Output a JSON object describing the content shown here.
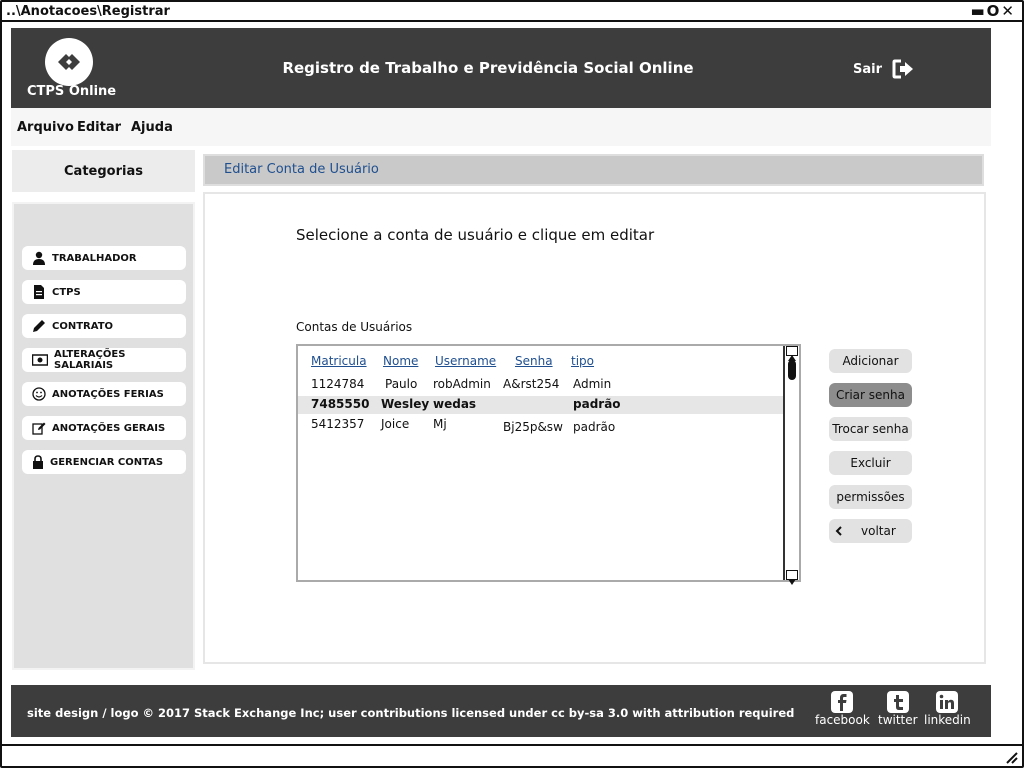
{
  "window": {
    "title": "..\\Anotacoes\\Registrar"
  },
  "header": {
    "logo_text": "CTPS Online",
    "title": "Registro de Trabalho e Previdência Social Online",
    "logout_label": "Sair"
  },
  "menu": {
    "items": [
      "Arquivo",
      "Editar",
      "Ajuda"
    ]
  },
  "sidebar": {
    "heading": "Categorias",
    "items": [
      {
        "label": "TRABALHADOR",
        "icon": "user-icon"
      },
      {
        "label": "CTPS",
        "icon": "document-icon"
      },
      {
        "label": "CONTRATO",
        "icon": "pencil-icon"
      },
      {
        "label": "ALTERAÇÕES SALARIAIS",
        "icon": "money-icon"
      },
      {
        "label": "ANOTAÇÕES FERIAS",
        "icon": "smile-icon"
      },
      {
        "label": "ANOTAÇÕES GERAIS",
        "icon": "edit-icon"
      },
      {
        "label": "GERENCIAR CONTAS",
        "icon": "lock-icon"
      }
    ]
  },
  "page": {
    "title": "Editar Conta de Usuário",
    "instruction": "Selecione a conta de usuário e clique em editar",
    "list_label": "Contas de Usuários"
  },
  "table": {
    "columns": [
      "Matricula",
      "Nome",
      "Username",
      "Senha",
      "tipo"
    ],
    "rows": [
      {
        "matricula": "1124784",
        "nome": "Paulo",
        "username": "robAdmin",
        "senha": "A&rst254",
        "tipo": "Admin"
      },
      {
        "matricula": "7485550",
        "nome": "Wesley",
        "username": "wedas",
        "senha": "",
        "tipo": "padrão",
        "selected": true
      },
      {
        "matricula": "5412357",
        "nome": "Joice",
        "username": "Mj",
        "senha": "Bj25p&sw",
        "tipo": "padrão"
      }
    ]
  },
  "actions": {
    "adicionar": "Adicionar",
    "criar_senha": "Criar senha",
    "trocar_senha": "Trocar senha",
    "excluir": "Excluir",
    "permissoes": "permissões",
    "voltar": "voltar"
  },
  "footer": {
    "copyright": "site design / logo © 2017 Stack Exchange Inc; user contributions licensed under cc by-sa 3.0 with attribution required",
    "social": {
      "facebook": "facebook",
      "twitter": "twitter",
      "linkedin": "linkedin"
    }
  },
  "colors": {
    "header_bg": "#3d3d3d",
    "link": "#1f4f8f",
    "active_button": "#8d8d8d"
  }
}
